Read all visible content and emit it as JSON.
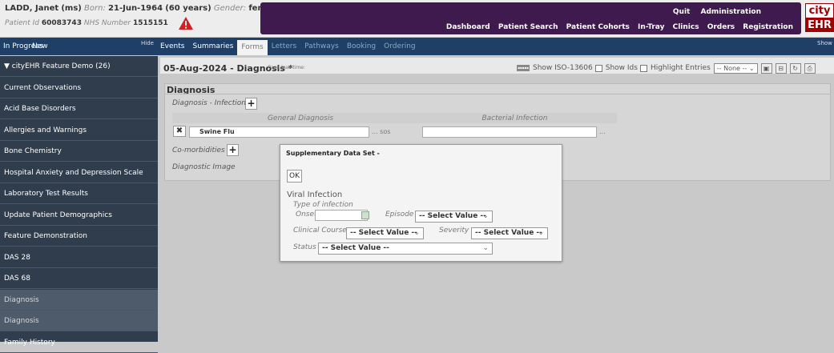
{
  "patient": {
    "name": "LADD, Janet",
    "title": "(ms)",
    "born_label": "Born:",
    "born": "21-Jun-1964",
    "age": "(60 years)",
    "gender_label": "Gender:",
    "gender": "female",
    "id_label": "Patient Id",
    "id": "60083743",
    "nhs_label": "NHS Number",
    "nhs": "1515151"
  },
  "nav": {
    "top": [
      "Quit",
      "Administration"
    ],
    "links": [
      "Dashboard",
      "Patient Search",
      "Patient Cohorts",
      "In-Tray",
      "Clinics",
      "Orders",
      "Registration"
    ]
  },
  "logo": {
    "line1": "city",
    "line2": "EHR"
  },
  "tabbar": {
    "in_progress": "In Progress",
    "new": "New",
    "hide": "Hide",
    "show": "Show",
    "form_tabs": [
      {
        "label": "Events",
        "state": "normal"
      },
      {
        "label": "Summaries",
        "state": "normal"
      },
      {
        "label": "Forms",
        "state": "active"
      },
      {
        "label": "Letters",
        "state": "muted"
      },
      {
        "label": "Pathways",
        "state": "muted"
      },
      {
        "label": "Booking",
        "state": "muted"
      },
      {
        "label": "Ordering",
        "state": "muted"
      }
    ]
  },
  "sidebar": {
    "items": [
      "▼ cityEHR Feature Demo (26)",
      "Current Observations",
      "Acid Base Disorders",
      "Allergies and Warnings",
      "Bone Chemistry",
      "Hospital Anxiety and Depression Scale",
      "Laboratory Test Results",
      "Update Patient Demographics",
      "Feature Demonstration",
      "DAS 28",
      "DAS 68",
      "Diagnosis",
      "Diagnosis",
      "Family History"
    ]
  },
  "form": {
    "title": "05-Aug-2024 - Diagnosis",
    "title_marker": "*",
    "page_load": "Page load time:",
    "show_iso": "Show ISO-13606",
    "show_ids": "Show Ids",
    "highlight": "Highlight Entries",
    "highlight_value": "-- None --",
    "qr": "▪▪▪▪▪",
    "section": "Diagnosis",
    "infection_label": "Diagnosis - Infection",
    "col_general": "General Diagnosis",
    "col_bacterial": "Bacterial Infection",
    "general_value": "Swine Flu",
    "general_suffix": "... sos",
    "bacterial_suffix": "...",
    "comorbidities": "Co-morbidities",
    "diagnostic_image": "Diagnostic Image"
  },
  "modal": {
    "title": "Supplementary Data Set -",
    "ok": "OK",
    "section": "Viral Infection",
    "type": "Type of infection",
    "onset_label": "Onset",
    "episode_label": "Episode",
    "clinical_label": "Clinical Course",
    "severity_label": "Severity",
    "status_label": "Status",
    "select_placeholder": "-- Select Value --"
  },
  "colors": {
    "nav_bg": "#3f1a4e",
    "tabbar_bg": "#1f3f66",
    "sidebar_bg": "#2f3d4c",
    "logo_red": "#a00000"
  }
}
